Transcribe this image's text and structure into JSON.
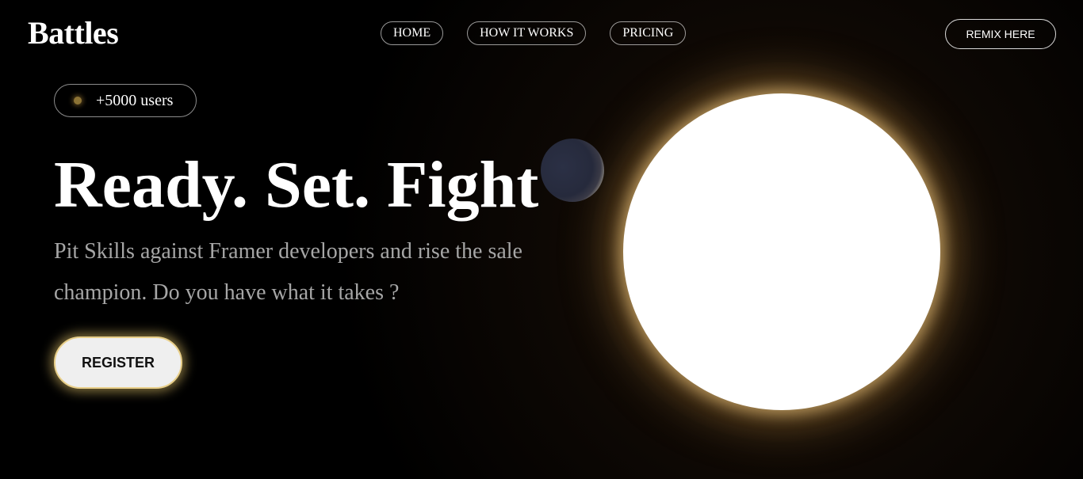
{
  "header": {
    "brand": "Battles",
    "nav": [
      {
        "label": "HOME"
      },
      {
        "label": "HOW IT WORKS"
      },
      {
        "label": "PRICING"
      }
    ],
    "cta_label": "REMIX HERE"
  },
  "badge": {
    "text": "+5000 users"
  },
  "hero": {
    "headline": "Ready. Set. Fight",
    "subtitle": "Pit Skills against Framer developers and rise the sale champion. Do you have what it takes ?",
    "register_label": "REGISTER"
  },
  "colors": {
    "background": "#000000",
    "accent_glow": "#e8cf8a",
    "sun": "#ffffff",
    "moon": "#262a3c"
  }
}
